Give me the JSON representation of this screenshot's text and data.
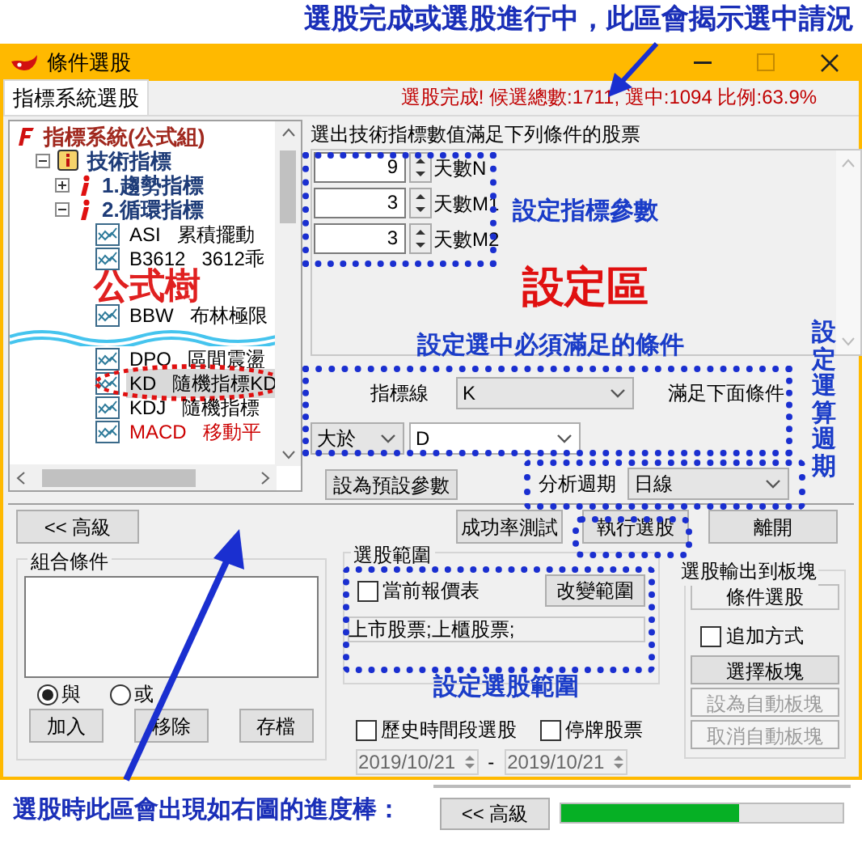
{
  "annotations": {
    "top_note": "選股完成或選股進行中，此區會揭示選中請況",
    "tree_note": "公式樹",
    "params_note": "設定指標參數",
    "area_note": "設定區",
    "condition_note": "設定選中必須滿足的條件",
    "period_note": "設定運算週期",
    "range_note": "設定選股範圍",
    "progress_note": "選股時此區會出現如右圖的進度棒："
  },
  "window": {
    "title": "條件選股"
  },
  "tabs": [
    {
      "label": "指標系統選股",
      "selected": true
    }
  ],
  "status": "選股完成! 候選總數:1711, 選中:1094 比例:63.9%",
  "tree": [
    {
      "label": "指標系統(公式組)",
      "kind": "root",
      "expanded": true,
      "children": [
        {
          "label": "技術指標",
          "kind": "group",
          "expanded": true,
          "children": [
            {
              "label": "1.趨勢指標",
              "kind": "folder",
              "expanded": false
            },
            {
              "label": "2.循環指標",
              "kind": "folder",
              "expanded": true,
              "children": [
                {
                  "code": "ASI",
                  "label": "累積擺動",
                  "kind": "indicator",
                  "selected": false,
                  "color": "#000000"
                },
                {
                  "code": "B3612",
                  "label": "3612乖",
                  "kind": "indicator",
                  "selected": false,
                  "color": "#000000"
                },
                {
                  "code": "BBW",
                  "label": "布林極限",
                  "kind": "indicator",
                  "selected": false,
                  "color": "#000000"
                },
                {
                  "code": "DPO",
                  "label": "區間震盪",
                  "kind": "indicator",
                  "selected": false,
                  "color": "#000000"
                },
                {
                  "code": "KD",
                  "label": "隨機指標KD",
                  "kind": "indicator",
                  "selected": true,
                  "color": "#000000"
                },
                {
                  "code": "KDJ",
                  "label": "隨機指標",
                  "kind": "indicator",
                  "selected": false,
                  "color": "#000000"
                },
                {
                  "code": "MACD",
                  "label": "移動平",
                  "kind": "indicator",
                  "selected": false,
                  "color": "#cc0000"
                }
              ]
            }
          ]
        }
      ]
    }
  ],
  "params_caption": "選出技術指標數值滿足下列條件的股票",
  "params": [
    {
      "value": "9",
      "label": "天數N"
    },
    {
      "value": "3",
      "label": "天數M1"
    },
    {
      "value": "3",
      "label": "天數M2"
    }
  ],
  "condition": {
    "line_label": "指標線",
    "line_value": "K",
    "suffix": "滿足下面條件",
    "operator": "大於",
    "target": "D"
  },
  "default_button": "設為預設參數",
  "period": {
    "label": "分析週期",
    "value": "日線"
  },
  "buttons": {
    "advanced": "<< 高級",
    "test": "成功率測試",
    "run": "執行選股",
    "exit": "離開"
  },
  "combo": {
    "title": "組合條件",
    "radios": [
      {
        "label": "與",
        "selected": true
      },
      {
        "label": "或",
        "selected": false
      }
    ],
    "buttons": [
      "加入",
      "移除",
      "存檔"
    ]
  },
  "range": {
    "title": "選股範圍",
    "checkbox": {
      "label": "當前報價表",
      "checked": false
    },
    "button": "改變範圍",
    "value": "上市股票;上櫃股票;"
  },
  "history": {
    "label": "歷史時間段選股",
    "checked": false
  },
  "suspended": {
    "label": "停牌股票",
    "checked": false
  },
  "dates": {
    "from": "2019/10/21",
    "separator": "-",
    "to": "2019/10/21"
  },
  "output": {
    "title": "選股輸出到板塊",
    "value": "條件選股",
    "append": {
      "label": "追加方式",
      "checked": false
    },
    "buttons": [
      {
        "label": "選擇板塊",
        "disabled": false
      },
      {
        "label": "設為自動板塊",
        "disabled": true
      },
      {
        "label": "取消自動板塊",
        "disabled": true
      }
    ]
  },
  "progress_preview": {
    "button": "<< 高級",
    "level": 0.63
  }
}
